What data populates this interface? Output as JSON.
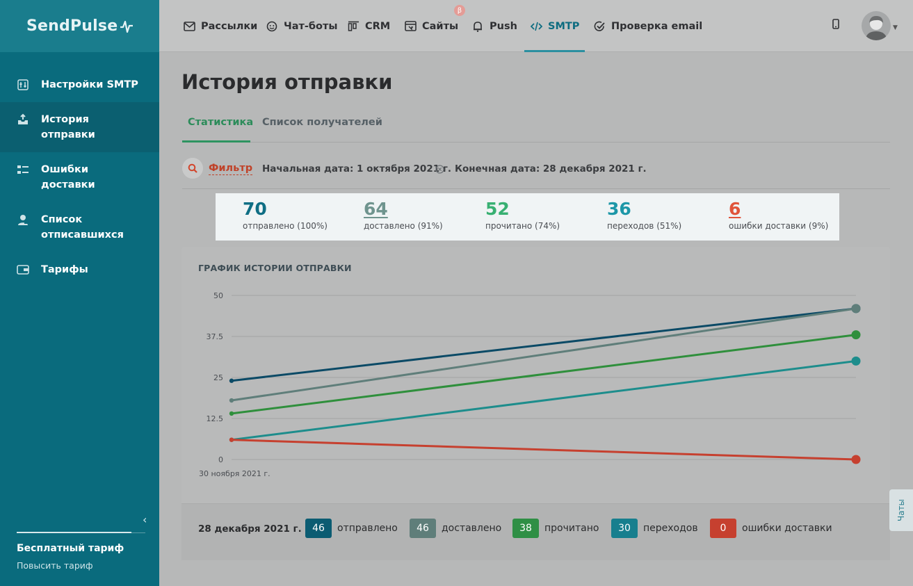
{
  "app": {
    "logo_text": "SendPulse"
  },
  "sidebar": {
    "items": [
      {
        "label": "Настройки SMTP",
        "icon": "sliders-icon",
        "active": false
      },
      {
        "label": "История отправки",
        "icon": "inbox-upload-icon",
        "active": true
      },
      {
        "label": "Ошибки доставки",
        "icon": "error-list-icon",
        "active": false
      },
      {
        "label": "Список отписавшихся",
        "icon": "user-minus-icon",
        "active": false
      },
      {
        "label": "Тарифы",
        "icon": "wallet-icon",
        "active": false
      }
    ],
    "plan_name": "Бесплатный тариф",
    "plan_upgrade": "Повысить тариф"
  },
  "topnav": {
    "items": [
      {
        "label": "Рассылки",
        "icon": "mail-icon"
      },
      {
        "label": "Чат-боты",
        "icon": "chatbot-icon"
      },
      {
        "label": "CRM",
        "icon": "crm-icon"
      },
      {
        "label": "Сайты",
        "icon": "website-icon"
      },
      {
        "label": "Push",
        "icon": "bell-icon"
      },
      {
        "label": "SMTP",
        "icon": "code-icon",
        "active": true
      },
      {
        "label": "Проверка email",
        "icon": "check-circle-icon"
      }
    ],
    "beta_badge": "β"
  },
  "page": {
    "title": "История отправки",
    "tabs": [
      {
        "label": "Статистика",
        "active": true
      },
      {
        "label": "Список получателей",
        "active": false
      }
    ],
    "filter": {
      "label": "Фильтр",
      "start_date": "Начальная дата: 1 октября 2021 г.",
      "end_date": "Конечная дата: 28 декабря 2021 г."
    },
    "stats": [
      {
        "value": "70",
        "label": "отправлено (100%)",
        "color": "#0f6e84"
      },
      {
        "value": "64",
        "label": "доставлено (91%)",
        "color": "#6f948e"
      },
      {
        "value": "52",
        "label": "прочитано (74%)",
        "color": "#38b072"
      },
      {
        "value": "36",
        "label": "переходов (51%)",
        "color": "#1d97a8"
      },
      {
        "value": "6",
        "label": "ошибки доставки (9%)",
        "color": "#e0543a"
      }
    ]
  },
  "chats_tab": "Чаты",
  "chart_data": {
    "type": "line",
    "title": "ГРАФИК ИСТОРИИ ОТПРАВКИ",
    "x": [
      "30 ноября 2021 г.",
      "28 декабря 2021 г."
    ],
    "x_tick_labels": [
      "30 ноября 2021 г."
    ],
    "ylim": [
      0,
      50
    ],
    "yticks": [
      "0",
      "12.5",
      "25",
      "37.5",
      "50"
    ],
    "grid": true,
    "series": [
      {
        "name": "отправлено",
        "values": [
          24,
          46
        ],
        "color": "#0b4a66"
      },
      {
        "name": "доставлено",
        "values": [
          18,
          46
        ],
        "color": "#5f7e7a"
      },
      {
        "name": "прочитано",
        "values": [
          14,
          38
        ],
        "color": "#2f8f3c"
      },
      {
        "name": "переходов",
        "values": [
          6,
          30
        ],
        "color": "#1d8d8c"
      },
      {
        "name": "ошибки доставки",
        "values": [
          6,
          0
        ],
        "color": "#c6402f"
      }
    ],
    "legend_date": "28 декабря 2021 г.",
    "legend": [
      {
        "value": "46",
        "label": "отправлено",
        "color": "#0b5c72"
      },
      {
        "value": "46",
        "label": "доставлено",
        "color": "#5f7e7a"
      },
      {
        "value": "38",
        "label": "прочитано",
        "color": "#2f8f45"
      },
      {
        "value": "30",
        "label": "переходов",
        "color": "#177f8e"
      },
      {
        "value": "0",
        "label": "ошибки доставки",
        "color": "#c6402f"
      }
    ]
  }
}
